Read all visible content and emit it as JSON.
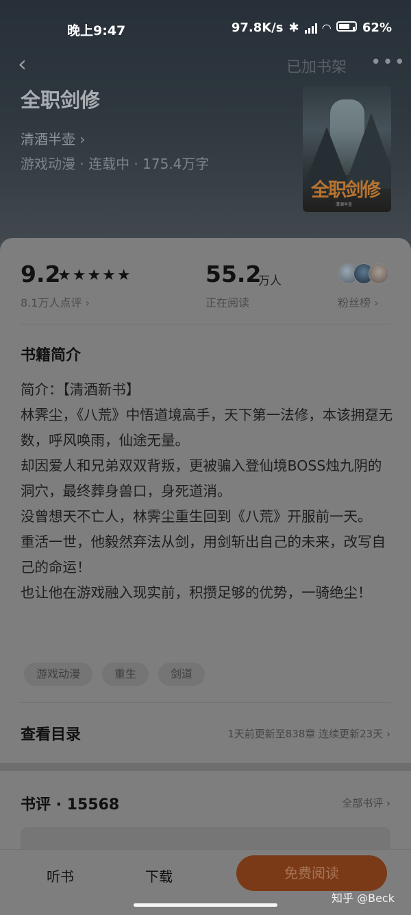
{
  "status_bar": {
    "time": "晚上9:47",
    "net_speed": "97.8K/s",
    "battery": "62%"
  },
  "nav": {
    "back_icon": "chevron-left-icon",
    "shelf_label": "已加书架",
    "more_icon": "more-dots-icon"
  },
  "book": {
    "title": "全职剑修",
    "author": "清酒半壶",
    "meta": "游戏动漫 · 连载中 · 175.4万字",
    "cover_text": "全职剑修",
    "cover_sub": "清酒半壶"
  },
  "stats": {
    "score": "9.2",
    "stars": "★★★★★",
    "rating_count": "8.1万人点评",
    "readers": "55.2",
    "readers_unit": "万人",
    "readers_label": "正在阅读",
    "fans_label": "粉丝榜"
  },
  "intro": {
    "title": "书籍简介",
    "paragraphs": [
      "简介：【清酒新书】",
      "林霁尘，《八荒》中悟道境高手，天下第一法修，本该拥趸无数，呼风唤雨，仙途无量。",
      "却因爱人和兄弟双双背叛，更被骗入登仙境BOSS烛九阴的洞穴，最终葬身兽口，身死道消。",
      "没曾想天不亡人，林霁尘重生回到《八荒》开服前一天。",
      "重活一世，他毅然弃法从剑，用剑斩出自己的未来，改写自己的命运！",
      "也让他在游戏融入现实前，积攒足够的优势，一骑绝尘！"
    ],
    "tags": [
      "游戏动漫",
      "重生",
      "剑道"
    ]
  },
  "toc": {
    "title": "查看目录",
    "info": "1天前更新至838章 连续更新23天"
  },
  "reviews": {
    "title": "书评 · 15568",
    "all_label": "全部书评"
  },
  "bottom": {
    "listen": "听书",
    "download": "下载",
    "read": "免费阅读"
  },
  "watermark": "知乎 @Beck",
  "colors": {
    "accent_button": "#7b3a17",
    "header_bg": "#2f383f",
    "dim_overlay": "#7e7e7e"
  }
}
